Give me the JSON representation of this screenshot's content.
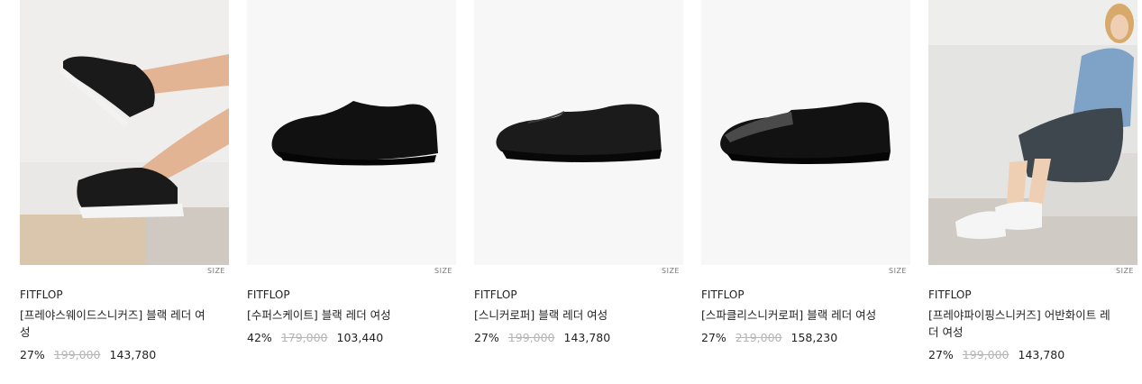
{
  "products": [
    {
      "brand": "FITFLOP",
      "name": "[프레야스웨이드스니커즈] 블랙 레더 여성",
      "discount": "27%",
      "original_price": "199,000",
      "sale_price": "143,780",
      "size_label": "SIZE",
      "image": "model-legs-black-sneakers"
    },
    {
      "brand": "FITFLOP",
      "name": "[수퍼스케이트] 블랙 레더 여성",
      "discount": "42%",
      "original_price": "179,000",
      "sale_price": "103,440",
      "size_label": "SIZE",
      "image": "black-glitter-slipon-shoe"
    },
    {
      "brand": "FITFLOP",
      "name": "[스니커로퍼] 블랙 레더 여성",
      "discount": "27%",
      "original_price": "199,000",
      "sale_price": "143,780",
      "size_label": "SIZE",
      "image": "black-leather-loafer"
    },
    {
      "brand": "FITFLOP",
      "name": "[스파클리스니커로퍼] 블랙 레더 여성",
      "discount": "27%",
      "original_price": "219,000",
      "sale_price": "158,230",
      "size_label": "SIZE",
      "image": "black-sparkle-loafer"
    },
    {
      "brand": "FITFLOP",
      "name": "[프레야파이핑스니커즈] 어반화이트 레더 여성",
      "discount": "27%",
      "original_price": "199,000",
      "sale_price": "143,780",
      "size_label": "SIZE",
      "image": "model-sitting-white-sneakers"
    }
  ]
}
